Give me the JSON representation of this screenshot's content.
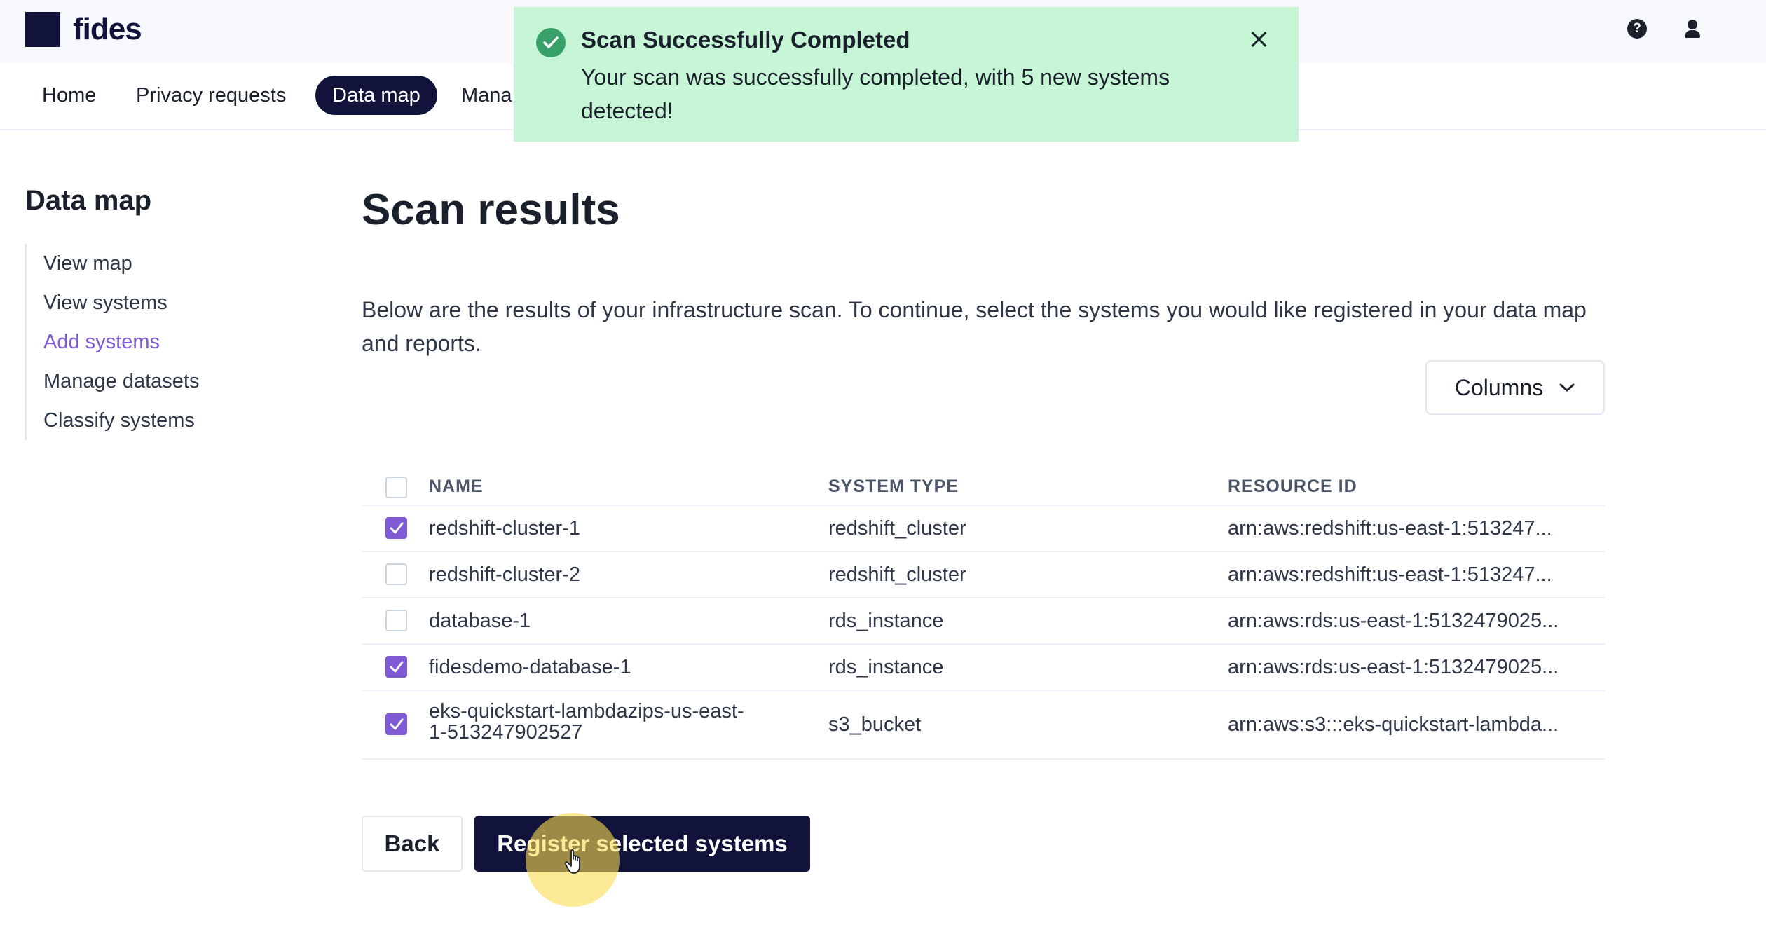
{
  "brand": {
    "name": "fides"
  },
  "header": {
    "help_icon": "?",
    "user_icon": "user-icon"
  },
  "nav": {
    "items": [
      {
        "label": "Home"
      },
      {
        "label": "Privacy requests"
      },
      {
        "label": "Data map",
        "active": true
      },
      {
        "label": "Mana"
      }
    ]
  },
  "toast": {
    "title": "Scan Successfully Completed",
    "message": "Your scan was successfully completed, with 5 new systems detected!",
    "status_color": "#38a169",
    "background": "#c6f6d5"
  },
  "sidebar": {
    "title": "Data map",
    "items": [
      {
        "label": "View map"
      },
      {
        "label": "View systems"
      },
      {
        "label": "Add systems",
        "active": true
      },
      {
        "label": "Manage datasets"
      },
      {
        "label": "Classify systems"
      }
    ]
  },
  "main": {
    "title": "Scan results",
    "intro": "Below are the results of your infrastructure scan. To continue, select the systems you would like registered in your data map and reports.",
    "columns_button": "Columns"
  },
  "table": {
    "headers": {
      "name": "NAME",
      "system_type": "SYSTEM TYPE",
      "resource_id": "RESOURCE ID"
    },
    "rows": [
      {
        "checked": true,
        "name": "redshift-cluster-1",
        "system_type": "redshift_cluster",
        "resource_id": "arn:aws:redshift:us-east-1:513247..."
      },
      {
        "checked": false,
        "name": "redshift-cluster-2",
        "system_type": "redshift_cluster",
        "resource_id": "arn:aws:redshift:us-east-1:513247..."
      },
      {
        "checked": false,
        "name": "database-1",
        "system_type": "rds_instance",
        "resource_id": "arn:aws:rds:us-east-1:5132479025..."
      },
      {
        "checked": true,
        "name": "fidesdemo-database-1",
        "system_type": "rds_instance",
        "resource_id": "arn:aws:rds:us-east-1:5132479025..."
      },
      {
        "checked": true,
        "name_line1": "eks-quickstart-lambdazips-us-east-",
        "name_line2": "1-513247902527",
        "system_type": "s3_bucket",
        "resource_id": "arn:aws:s3:::eks-quickstart-lambda..."
      }
    ]
  },
  "actions": {
    "back": "Back",
    "register": "Register selected systems"
  },
  "colors": {
    "primary": "#11133b",
    "accent": "#805ad5"
  }
}
